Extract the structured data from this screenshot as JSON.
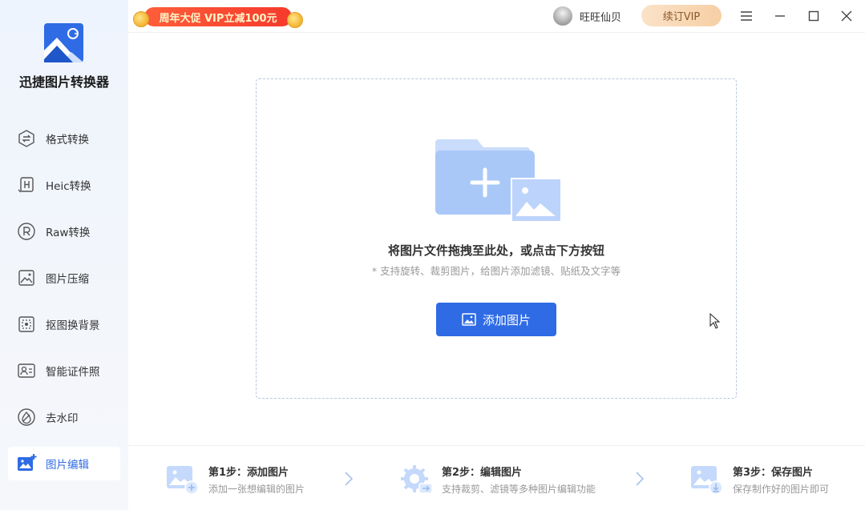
{
  "app": {
    "name": "迅捷图片转换器"
  },
  "promo": {
    "text": "周年大促 VIP立减100元"
  },
  "user": {
    "name": "旺旺仙贝",
    "renew_label": "续订VIP"
  },
  "sidebar": {
    "items": [
      {
        "label": "格式转换",
        "icon": "swap-icon"
      },
      {
        "label": "Heic转换",
        "icon": "heic-icon"
      },
      {
        "label": "Raw转换",
        "icon": "raw-icon"
      },
      {
        "label": "图片压缩",
        "icon": "compress-icon"
      },
      {
        "label": "抠图换背景",
        "icon": "cutout-icon"
      },
      {
        "label": "智能证件照",
        "icon": "id-photo-icon"
      },
      {
        "label": "去水印",
        "icon": "watermark-icon"
      },
      {
        "label": "图片编辑",
        "icon": "image-edit-icon",
        "active": true
      }
    ]
  },
  "dropzone": {
    "title": "将图片文件拖拽至此处，或点击下方按钮",
    "hint": "* 支持旋转、裁剪图片，给图片添加滤镜、贴纸及文字等",
    "button_label": "添加图片"
  },
  "steps": [
    {
      "title": "第1步：添加图片",
      "desc": "添加一张想编辑的图片"
    },
    {
      "title": "第2步：编辑图片",
      "desc": "支持裁剪、滤镜等多种图片编辑功能"
    },
    {
      "title": "第3步：保存图片",
      "desc": "保存制作好的图片即可"
    }
  ],
  "colors": {
    "accent": "#2f6be4",
    "promo": "#f53a2c",
    "vip": "#f6cfa4"
  }
}
